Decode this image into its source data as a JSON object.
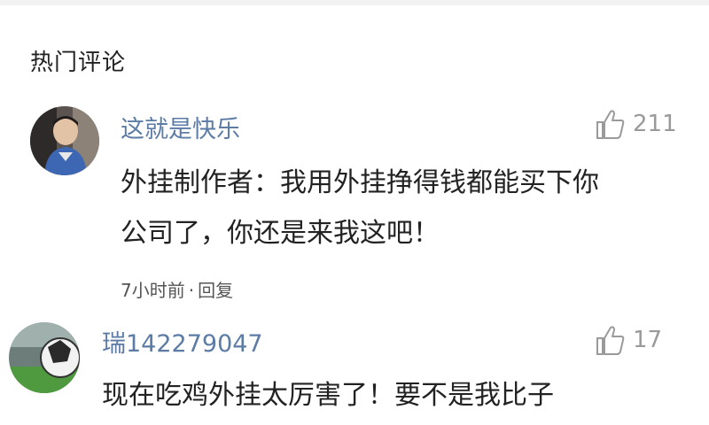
{
  "section_title": "热门评论",
  "comments": [
    {
      "username": "这就是快乐",
      "likes": "211",
      "text_line1": "外挂制作者：我用外挂挣得钱都能买下你",
      "text_line2": "公司了，你还是来我这吧！",
      "time": "7小时前",
      "reply": "回复"
    },
    {
      "username": "瑞142279047",
      "likes": "17",
      "text_line1": "现在吃鸡外挂太厉害了！要不是我比子"
    }
  ],
  "icons": {
    "like": "thumbs-up-icon"
  }
}
